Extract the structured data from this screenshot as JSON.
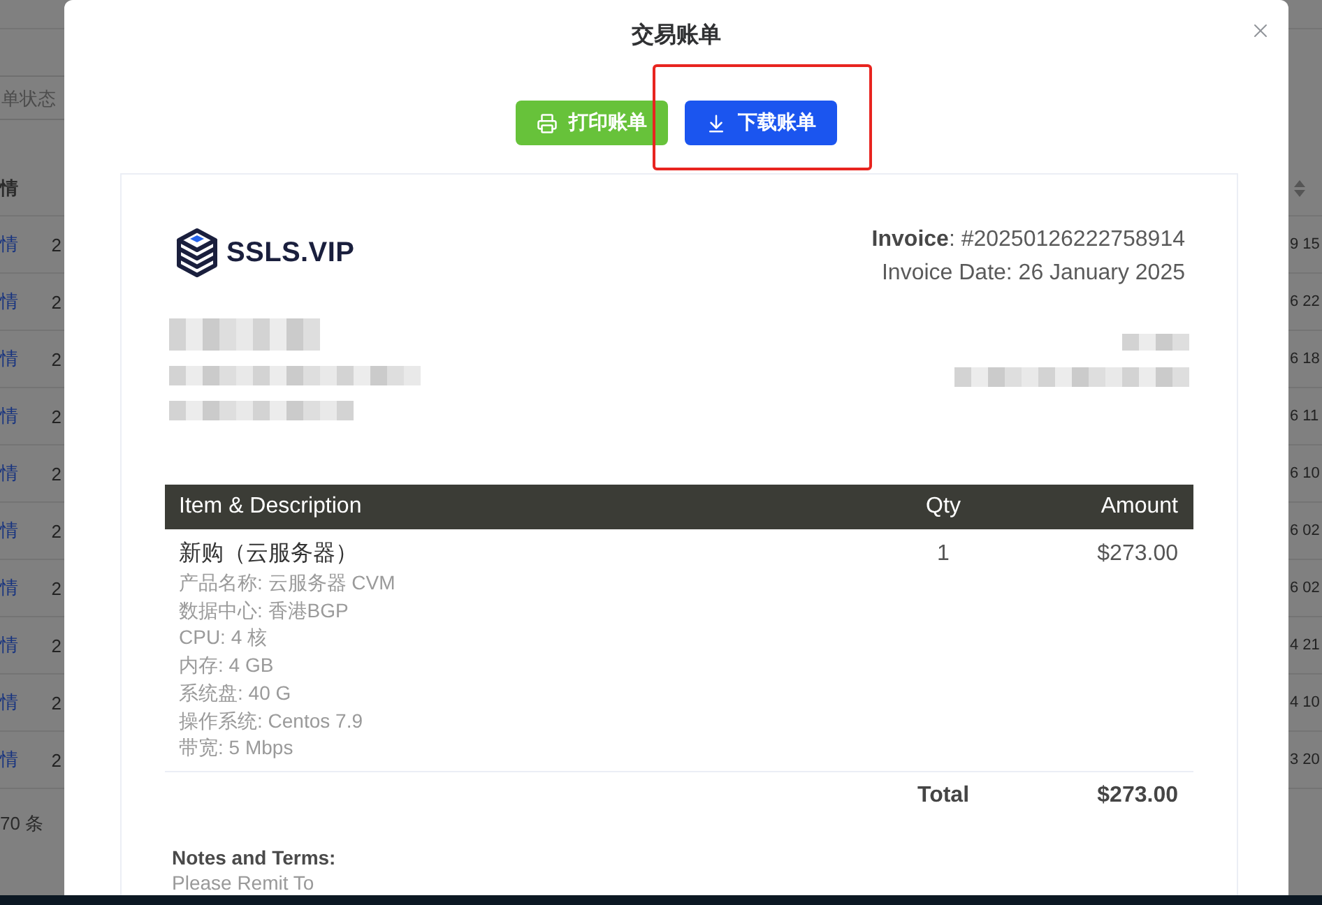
{
  "background_page": {
    "filter_field": {
      "placeholder": "单状态"
    },
    "table": {
      "header": {
        "column_1": "情"
      },
      "rows": [
        {
          "column_1": "情",
          "column_2": "2",
          "column_3": "9 15"
        },
        {
          "column_1": "情",
          "column_2": "2",
          "column_3": "6 22"
        },
        {
          "column_1": "情",
          "column_2": "2",
          "column_3": "6 18"
        },
        {
          "column_1": "情",
          "column_2": "2",
          "column_3": "6 11"
        },
        {
          "column_1": "情",
          "column_2": "2",
          "column_3": "6 10"
        },
        {
          "column_1": "情",
          "column_2": "2",
          "column_3": "6 02"
        },
        {
          "column_1": "情",
          "column_2": "2",
          "column_3": "6 02"
        },
        {
          "column_1": "情",
          "column_2": "2",
          "column_3": "4 21"
        },
        {
          "column_1": "情",
          "column_2": "2",
          "column_3": "4 10"
        },
        {
          "column_1": "情",
          "column_2": "2",
          "column_3": "3 20"
        }
      ]
    },
    "pagination": {
      "total": "70 条"
    }
  },
  "dialog": {
    "title": "交易账单",
    "buttons": [
      {
        "kind": "print",
        "label": "打印账单",
        "highlighted": false
      },
      {
        "kind": "download",
        "label": "下载账单",
        "highlighted": true
      }
    ],
    "invoice": {
      "logo_text": "SSLS.VIP",
      "number": "**Invoice**: #20250126222758914",
      "date": "Invoice Date: 26 January 2025",
      "table": {
        "columns": [
          "Item & Description",
          "Qty",
          "Amount"
        ],
        "rows": [
          {
            "item": "新购（云服务器）",
            "details": [
              "产品名称: 云服务器 CVM",
              "数据中心: 香港BGP",
              "CPU: 4 核",
              "内存: 4 GB",
              "系统盘: 40 G",
              "操作系统: Centos 7.9",
              "带宽: 5 Mbps"
            ],
            "qty": "1",
            "amount": "$273.00"
          }
        ],
        "total": {
          "label": "Total",
          "amount": "$273.00"
        }
      },
      "notes": {
        "title": "Notes and Terms:",
        "lines": [
          "Please Remit To"
        ]
      }
    }
  }
}
